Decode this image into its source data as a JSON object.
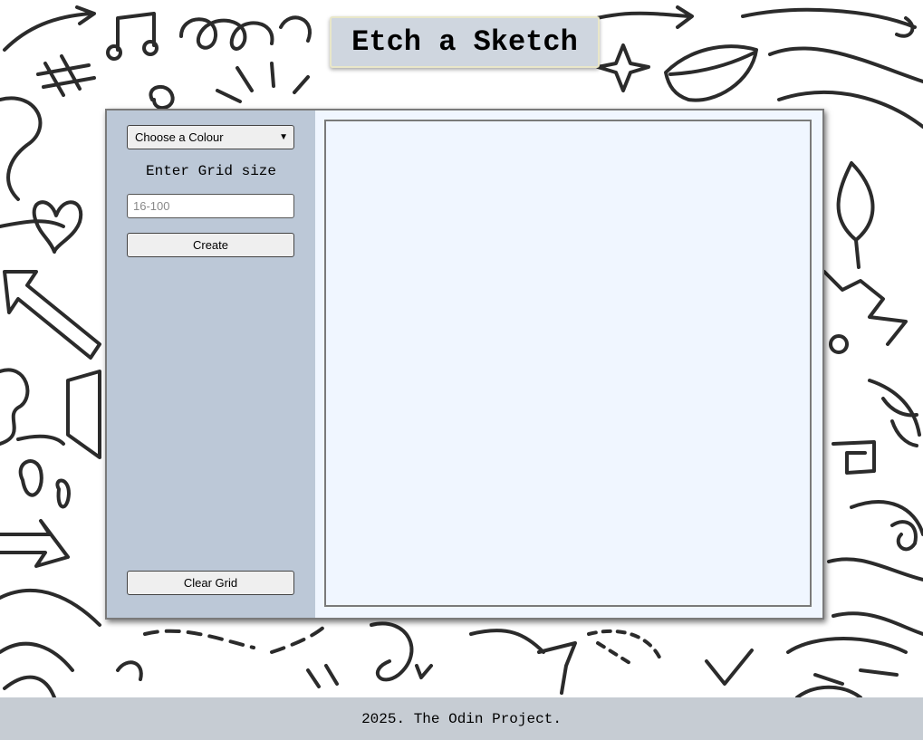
{
  "header": {
    "title": "Etch a Sketch"
  },
  "sidebar": {
    "colour_select": {
      "selected": "Choose a Colour"
    },
    "grid_size_label": "Enter Grid size",
    "grid_size_input": {
      "value": "",
      "placeholder": "16-100"
    },
    "create_label": "Create",
    "clear_label": "Clear Grid"
  },
  "footer": {
    "text": "2025. The Odin Project."
  },
  "colors": {
    "sidebar_bg": "#bcc8d7",
    "grid_bg": "#f0f6ff",
    "title_bg": "#cfd6df",
    "footer_bg": "#c6ccd3"
  },
  "icons": {
    "select_caret": "chevron-down-icon"
  }
}
